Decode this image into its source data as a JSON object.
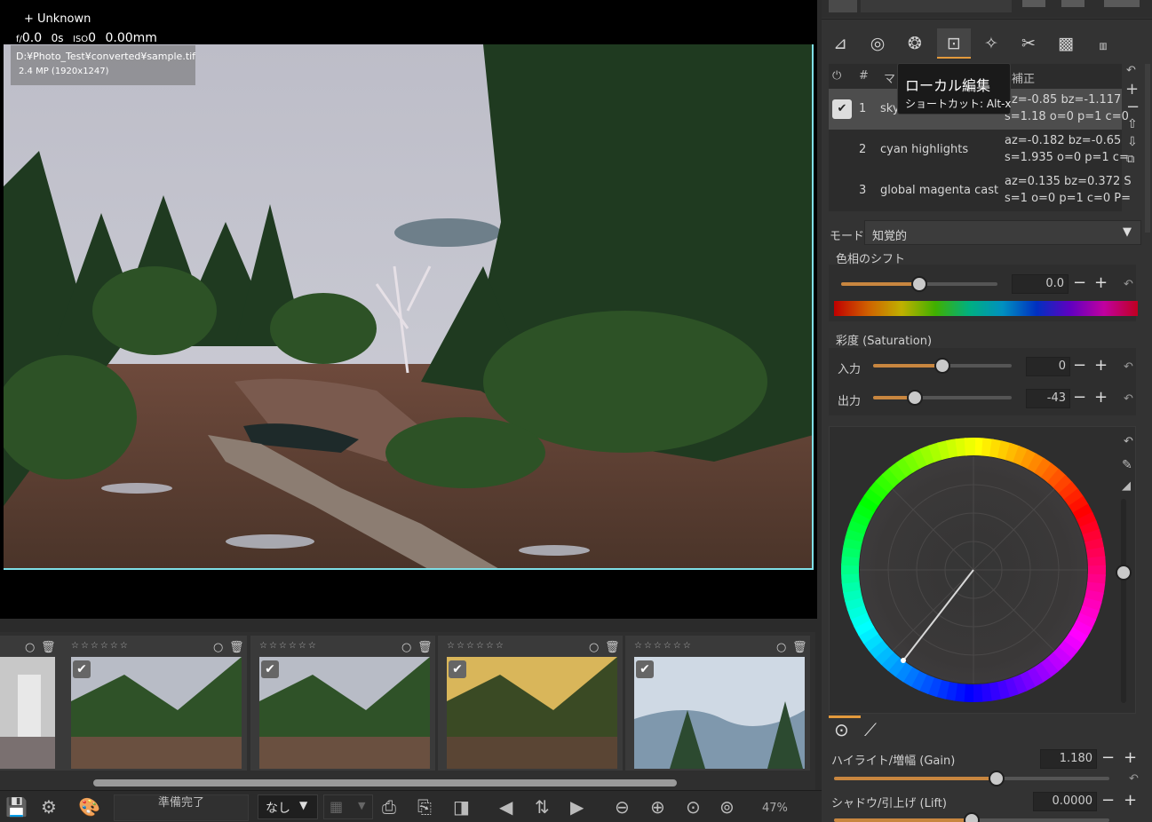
{
  "viewer": {
    "camera": "+ Unknown",
    "exposure": {
      "f": "f/",
      "fval": "0.0",
      "s": "0s",
      "iso": "ISO",
      "isoval": "0",
      "mm": "0.00mm"
    },
    "filepath": "D:¥Photo_Test¥converted¥sample.tif",
    "resolution": "2.4 MP (1920x1247)"
  },
  "tooltip": {
    "title": "ローカル編集",
    "shortcut": "ショートカット: Alt-x"
  },
  "mask_list": {
    "headers": {
      "enable": "⏻",
      "num": "#",
      "mask": "マ",
      "correction": "補正"
    },
    "rows": [
      {
        "num": "1",
        "name": "sky",
        "params1": "az=-0.85 bz=-1.117",
        "params2": "s=1.18 o=0 p=1 c=0"
      },
      {
        "num": "2",
        "name": "cyan highlights",
        "params1": "az=-0.182 bz=-0.65",
        "params2": "s=1.935 o=0 p=1 c="
      },
      {
        "num": "3",
        "name": "global magenta cast",
        "params1": "az=0.135 bz=0.372 S",
        "params2": "s=1 o=0 p=1 c=0 P="
      }
    ]
  },
  "mode": {
    "label": "モード:",
    "value": "知覚的"
  },
  "hue_shift": {
    "label": "色相のシフト",
    "value": "0.0",
    "fraction": 0.5
  },
  "saturation": {
    "label": "彩度 (Saturation)",
    "input_label": "入力",
    "input_value": "0",
    "input_fraction": 0.5,
    "output_label": "出力",
    "output_value": "-43",
    "output_fraction": 0.3
  },
  "gain": {
    "label": "ハイライト/増幅 (Gain)",
    "value": "1.180",
    "fraction": 0.59
  },
  "lift": {
    "label": "シャドウ/引上げ (Lift)",
    "value": "0.0000",
    "fraction": 0.5
  },
  "bottombar": {
    "status": "準備完了",
    "select_value": "なし",
    "zoom": "47%"
  },
  "filmstrip": {
    "stars": "☆☆☆☆☆☆"
  },
  "symbols": {
    "plus": "+",
    "minus": "−",
    "reset": "↶",
    "check": "✔"
  }
}
